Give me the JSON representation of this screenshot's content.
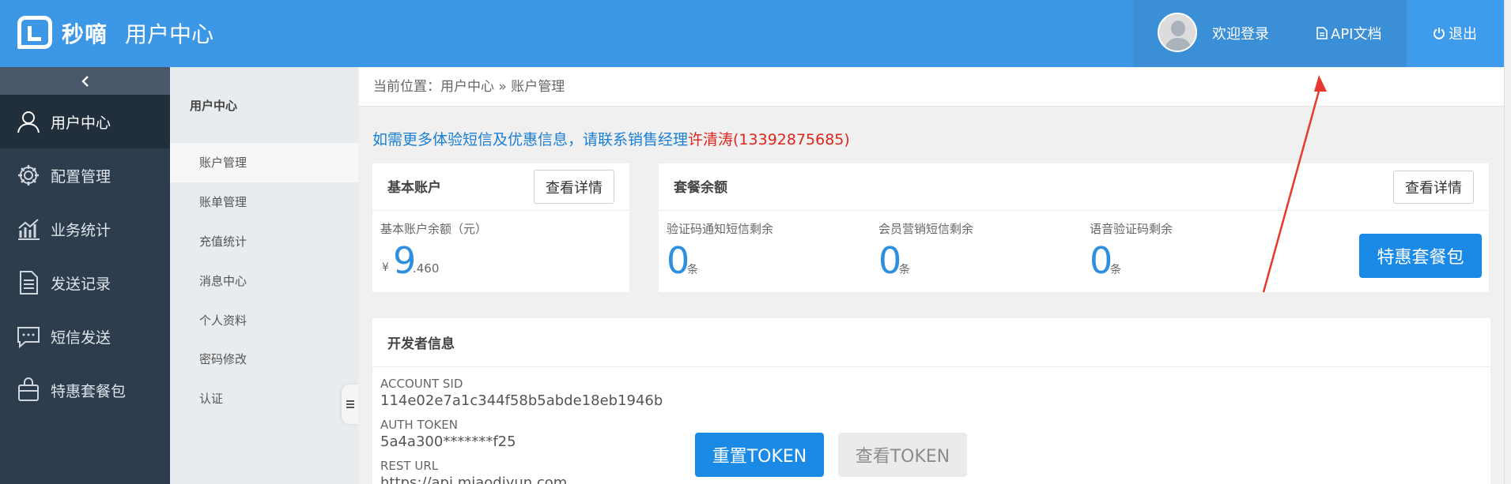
{
  "header": {
    "logo_text": "秒嘀",
    "app_title": "用户中心",
    "welcome": "欢迎登录",
    "api_doc": "API文档",
    "logout": "退出"
  },
  "sidebar": {
    "collapse_icon": "chevron-left-icon",
    "items": [
      {
        "label": "用户中心",
        "icon": "user-icon"
      },
      {
        "label": "配置管理",
        "icon": "gear-icon"
      },
      {
        "label": "业务统计",
        "icon": "chart-icon"
      },
      {
        "label": "发送记录",
        "icon": "document-icon"
      },
      {
        "label": "短信发送",
        "icon": "message-icon"
      },
      {
        "label": "特惠套餐包",
        "icon": "bag-icon"
      }
    ]
  },
  "submenu": {
    "title": "用户中心",
    "items": [
      "账户管理",
      "账单管理",
      "充值统计",
      "消息中心",
      "个人资料",
      "密码修改",
      "认证"
    ]
  },
  "breadcrumb": "当前位置：用户中心 » 账户管理",
  "notice": {
    "text": "如需更多体验短信及优惠信息，请联系销售经理",
    "contact": "许清涛(13392875685)"
  },
  "basic_account": {
    "title": "基本账户",
    "detail_button": "查看详情",
    "balance_label": "基本账户余额（元）",
    "currency": "¥",
    "balance_int": "9",
    "balance_dec": ".460"
  },
  "package": {
    "title": "套餐余额",
    "detail_button": "查看详情",
    "items": [
      {
        "label": "验证码通知短信剩余",
        "value": "0",
        "unit": "条"
      },
      {
        "label": "会员营销短信剩余",
        "value": "0",
        "unit": "条"
      },
      {
        "label": "语音验证码剩余",
        "value": "0",
        "unit": "条"
      }
    ],
    "promo_button": "特惠套餐包"
  },
  "developer": {
    "title": "开发者信息",
    "account_sid_label": "ACCOUNT SID",
    "account_sid": "114e02e7a1c344f58b5abde18eb1946b",
    "auth_token_label": "AUTH TOKEN",
    "auth_token": "5a4a300*******f25",
    "rest_url_label": "REST URL",
    "rest_url": "https://api.miaodiyun.com",
    "reset_button": "重置TOKEN",
    "view_button": "查看TOKEN"
  },
  "colors": {
    "header": "#3c98e6",
    "sidebar": "#2e3d4d",
    "accent": "#1a8ae6",
    "contact": "#e0261c"
  }
}
